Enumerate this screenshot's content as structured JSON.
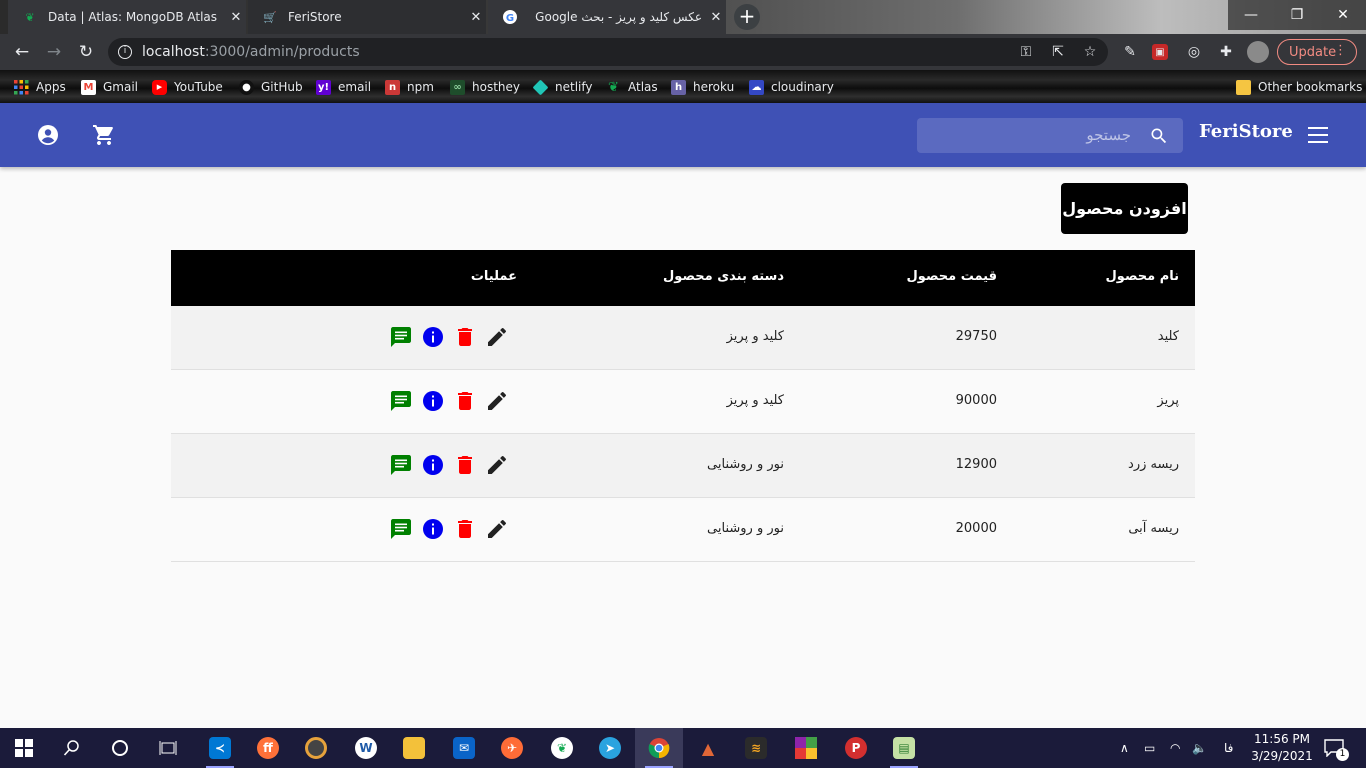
{
  "browser": {
    "tabs": [
      {
        "title": "Data | Atlas: MongoDB Atlas",
        "close": "✕"
      },
      {
        "title": "FeriStore",
        "close": "✕"
      },
      {
        "title": "عکس کلید و پریز - بحث Google",
        "close": "✕"
      }
    ],
    "new_tab": "+",
    "address": {
      "host": "localhost",
      "path": ":3000/admin/products"
    },
    "update_label": "Update",
    "bookmarks": [
      {
        "label": "Apps",
        "icon": "apps-grid-icon",
        "color": "#ea4335"
      },
      {
        "label": "Gmail",
        "icon": "gmail-icon",
        "color": "#ea4335"
      },
      {
        "label": "YouTube",
        "icon": "youtube-icon",
        "color": "#ff0000"
      },
      {
        "label": "GitHub",
        "icon": "github-icon",
        "color": "#24292e"
      },
      {
        "label": "email",
        "icon": "yahoo-icon",
        "color": "#6001d2"
      },
      {
        "label": "npm",
        "icon": "npm-icon",
        "color": "#cb3837"
      },
      {
        "label": "hosthey",
        "icon": "hosthey-icon",
        "color": "#2e7d32"
      },
      {
        "label": "netlify",
        "icon": "netlify-icon",
        "color": "#20c6b7"
      },
      {
        "label": "Atlas",
        "icon": "mongodb-leaf-icon",
        "color": "#13aa52"
      },
      {
        "label": "heroku",
        "icon": "heroku-icon",
        "color": "#6762a6"
      },
      {
        "label": "cloudinary",
        "icon": "cloudinary-icon",
        "color": "#3448c5"
      }
    ],
    "other_bookmarks": "Other bookmarks"
  },
  "app": {
    "brand": "FeriStore",
    "search_placeholder": "جستجو",
    "add_product_label": "افزودن محصول",
    "accent": "#3f51b5",
    "table": {
      "headers": {
        "name": "نام محصول",
        "price": "قیمت محصول",
        "category": "دسته بندی محصول",
        "actions": "عملیات"
      },
      "rows": [
        {
          "name": "کلید",
          "price": "29750",
          "category": "کلید و پریز"
        },
        {
          "name": "پریز",
          "price": "90000",
          "category": "کلید و پریز"
        },
        {
          "name": "ریسه زرد",
          "price": "12900",
          "category": "نور و روشنایی"
        },
        {
          "name": "ریسه آبی",
          "price": "20000",
          "category": "نور و روشنایی"
        }
      ],
      "action_colors": {
        "edit": "#222222",
        "delete": "#ff0000",
        "info": "#0000ee",
        "comment": "#008000"
      }
    }
  },
  "taskbar": {
    "lang": "فا",
    "time": "11:56 PM",
    "date": "3/29/2021",
    "notifications": "1"
  }
}
